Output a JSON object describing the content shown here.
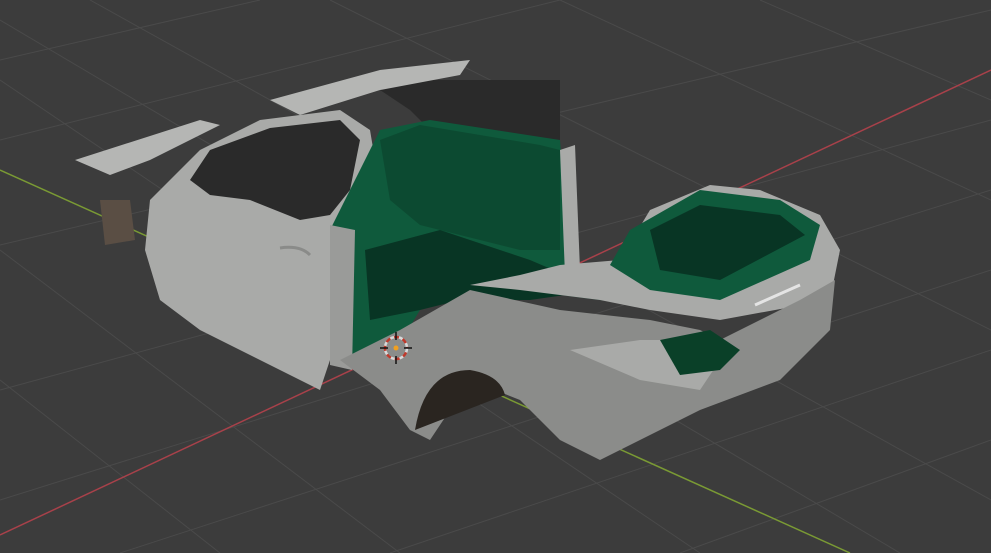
{
  "viewport": {
    "background": "#3c3c3c",
    "grid_color": "#4a4a4a",
    "x_axis_color": "#a8414a",
    "y_axis_color": "#7a9a34"
  },
  "model": {
    "body_color": "#a9aaa8",
    "body_shadow": "#8b8c8a",
    "interior_color": "#0f5a3c",
    "interior_dark": "#083524",
    "glass_color": "#2a2a2a"
  },
  "cursor_3d": {
    "ring_outer": "#d9d9d9",
    "ring_inner": "#c0392b"
  }
}
